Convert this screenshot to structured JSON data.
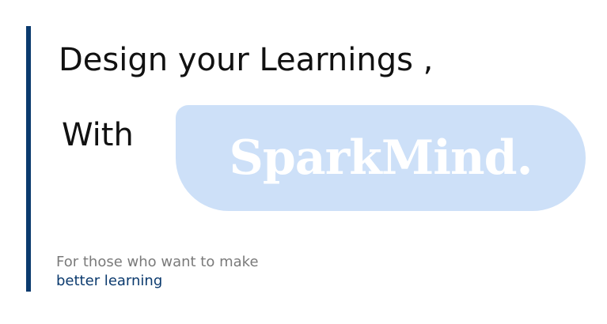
{
  "headline": "Design your Learnings ,",
  "with_label": "With",
  "brand": {
    "name": "SparkMind."
  },
  "tagline": {
    "line1": "For those who want to make",
    "line2": "better learning"
  },
  "colors": {
    "accent": "#0b3a6e",
    "pill": "#cde0f8",
    "brand_text": "#ffffff",
    "muted_text": "#7a7a7a"
  }
}
